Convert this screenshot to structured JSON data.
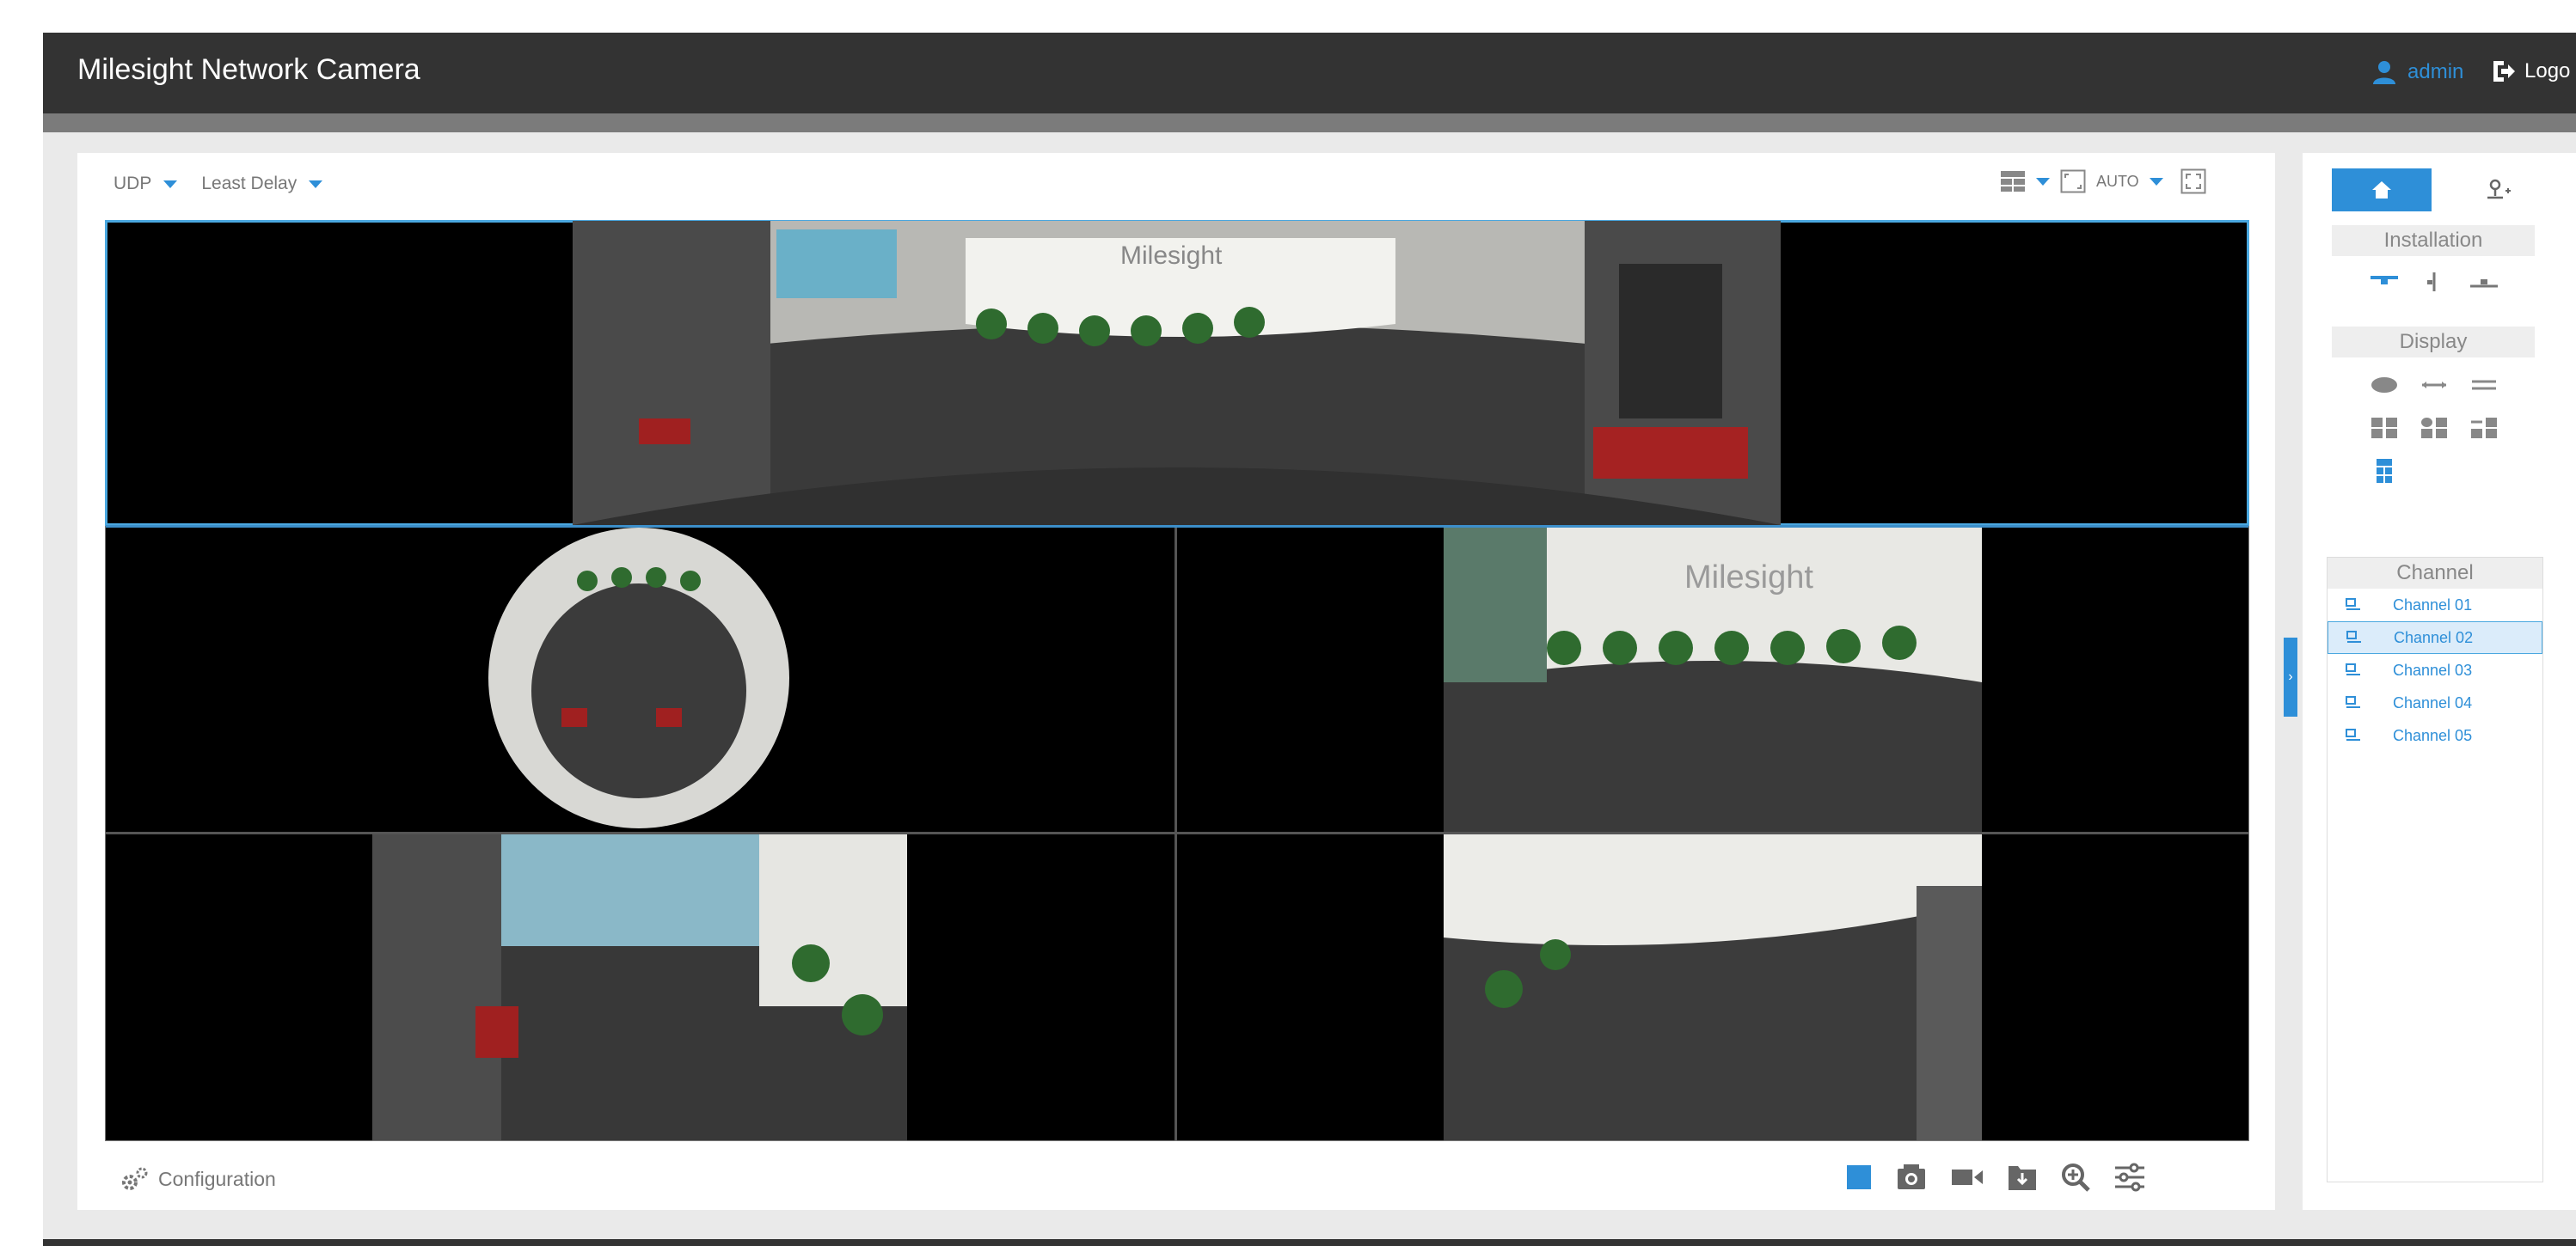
{
  "header": {
    "title": "Milesight Network Camera",
    "user": "admin",
    "logout_label": "Logo"
  },
  "stream": {
    "protocol": "UDP",
    "mode": "Least Delay"
  },
  "toolbar": {
    "aspect": "AUTO"
  },
  "footer": {
    "config_label": "Configuration"
  },
  "panel": {
    "installation_label": "Installation",
    "display_label": "Display",
    "channel_header": "Channel",
    "channels": [
      "Channel 01",
      "Channel 02",
      "Channel 03",
      "Channel 04",
      "Channel 05"
    ],
    "selected_channel": "Channel 02"
  },
  "colors": {
    "accent": "#2e8fd8",
    "header": "#333333",
    "selection": "#4aa8e0"
  }
}
